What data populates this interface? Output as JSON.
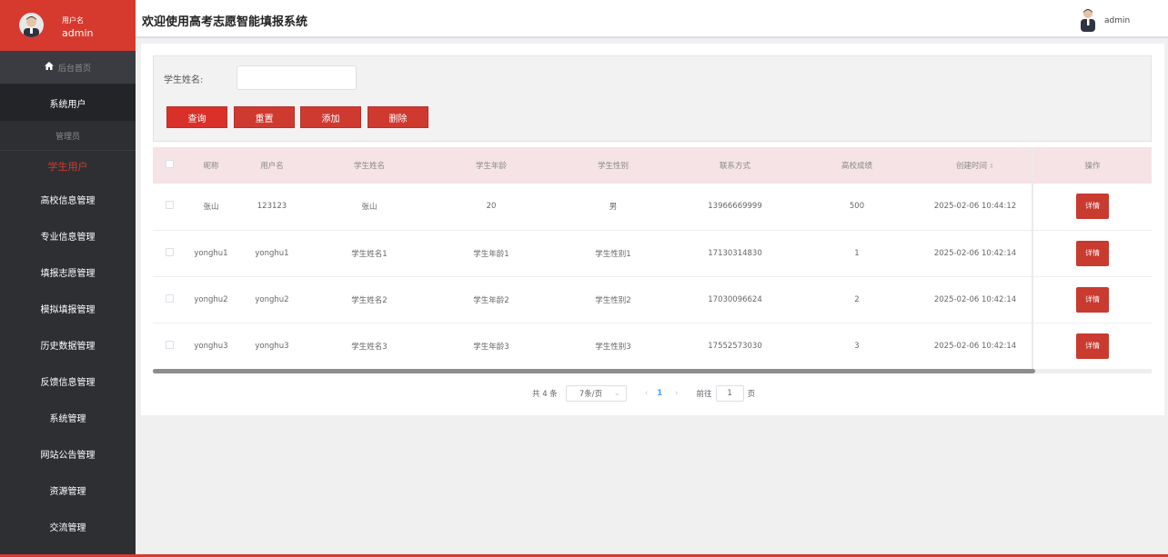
{
  "sidebar": {
    "user_label": "用户名",
    "user_name": "admin",
    "home": "后台首页",
    "items": [
      {
        "label": "系统用户"
      },
      {
        "label": "管理员"
      },
      {
        "label": "学生用户"
      },
      {
        "label": "高校信息管理"
      },
      {
        "label": "专业信息管理"
      },
      {
        "label": "填报志愿管理"
      },
      {
        "label": "模拟填报管理"
      },
      {
        "label": "历史数据管理"
      },
      {
        "label": "反馈信息管理"
      },
      {
        "label": "系统管理"
      },
      {
        "label": "网站公告管理"
      },
      {
        "label": "资源管理"
      },
      {
        "label": "交流管理"
      }
    ]
  },
  "header": {
    "title": "欢迎使用高考志愿智能填报系统",
    "admin_name": "admin"
  },
  "search": {
    "label": "学生姓名:",
    "value": "",
    "buttons": {
      "query": "查询",
      "reset": "重置",
      "add": "添加",
      "delete": "删除"
    }
  },
  "table": {
    "columns": [
      "昵称",
      "用户名",
      "学生姓名",
      "学生年龄",
      "学生性别",
      "联系方式",
      "高校成绩",
      "创建时间",
      "操作"
    ],
    "rows": [
      {
        "nickname": "张山",
        "username": "123123",
        "name": "张山",
        "age": "20",
        "gender": "男",
        "phone": "13966669999",
        "score": "500",
        "created": "2025-02-06 10:44:12"
      },
      {
        "nickname": "yonghu1",
        "username": "yonghu1",
        "name": "学生姓名1",
        "age": "学生年龄1",
        "gender": "学生性别1",
        "phone": "17130314830",
        "score": "1",
        "created": "2025-02-06 10:42:14"
      },
      {
        "nickname": "yonghu2",
        "username": "yonghu2",
        "name": "学生姓名2",
        "age": "学生年龄2",
        "gender": "学生性别2",
        "phone": "17030096624",
        "score": "2",
        "created": "2025-02-06 10:42:14"
      },
      {
        "nickname": "yonghu3",
        "username": "yonghu3",
        "name": "学生姓名3",
        "age": "学生年龄3",
        "gender": "学生性别3",
        "phone": "17552573030",
        "score": "3",
        "created": "2025-02-06 10:42:14"
      }
    ],
    "detail_label": "详情"
  },
  "pagination": {
    "total": "共 4 条",
    "page_size": "7条/页",
    "current": "1",
    "goto_label": "前往",
    "goto_value": "1",
    "page_suffix": "页"
  },
  "colors": {
    "accent": "#d63a2f",
    "sidebar_bg": "#2d2f33",
    "header_row_bg": "#f5e3e5"
  }
}
